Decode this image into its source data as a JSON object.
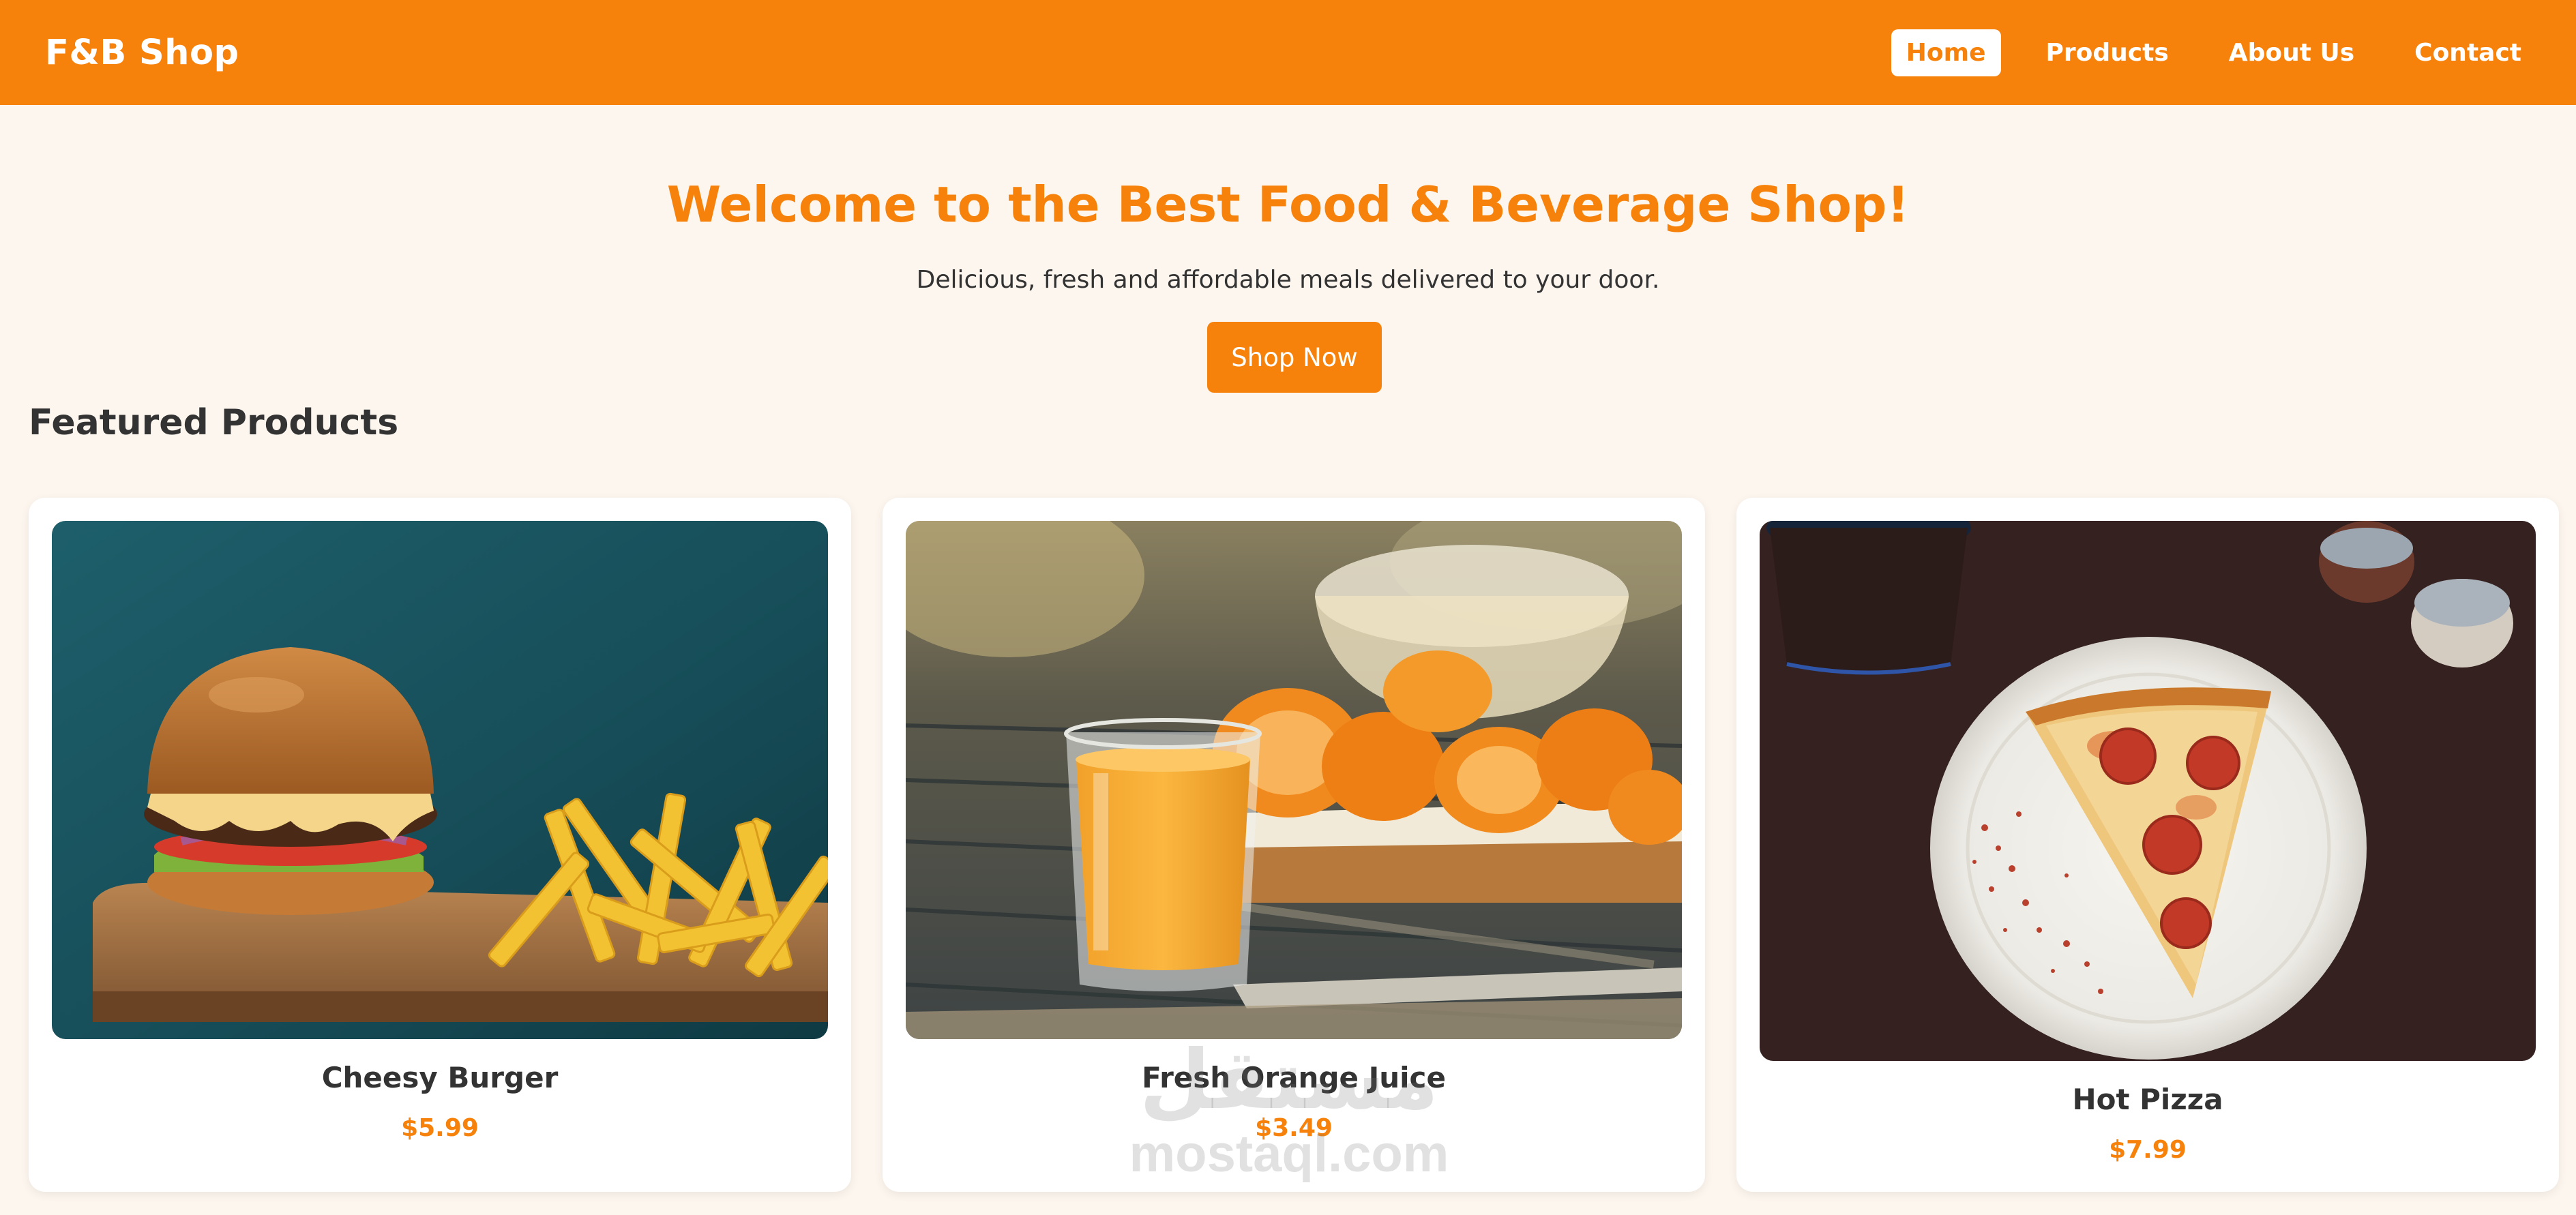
{
  "nav": {
    "brand": "F&B Shop",
    "links": [
      {
        "label": "Home",
        "active": true
      },
      {
        "label": "Products",
        "active": false
      },
      {
        "label": "About Us",
        "active": false
      },
      {
        "label": "Contact",
        "active": false
      }
    ]
  },
  "hero": {
    "title": "Welcome to the Best Food & Beverage Shop!",
    "subtitle": "Delicious, fresh and affordable meals delivered to your door.",
    "cta_label": "Shop Now"
  },
  "featured": {
    "heading": "Featured Products",
    "products": [
      {
        "name": "Cheesy Burger",
        "price": "$5.99",
        "image": "burger-photo"
      },
      {
        "name": "Fresh Orange Juice",
        "price": "$3.49",
        "image": "orange-juice-photo"
      },
      {
        "name": "Hot Pizza",
        "price": "$7.99",
        "image": "pizza-photo"
      }
    ]
  },
  "watermark": {
    "logo": "مستقل",
    "text": "mostaql.com"
  },
  "colors": {
    "accent": "#f7820b",
    "background": "#fdf6ee",
    "text": "#333333",
    "card": "#ffffff"
  }
}
